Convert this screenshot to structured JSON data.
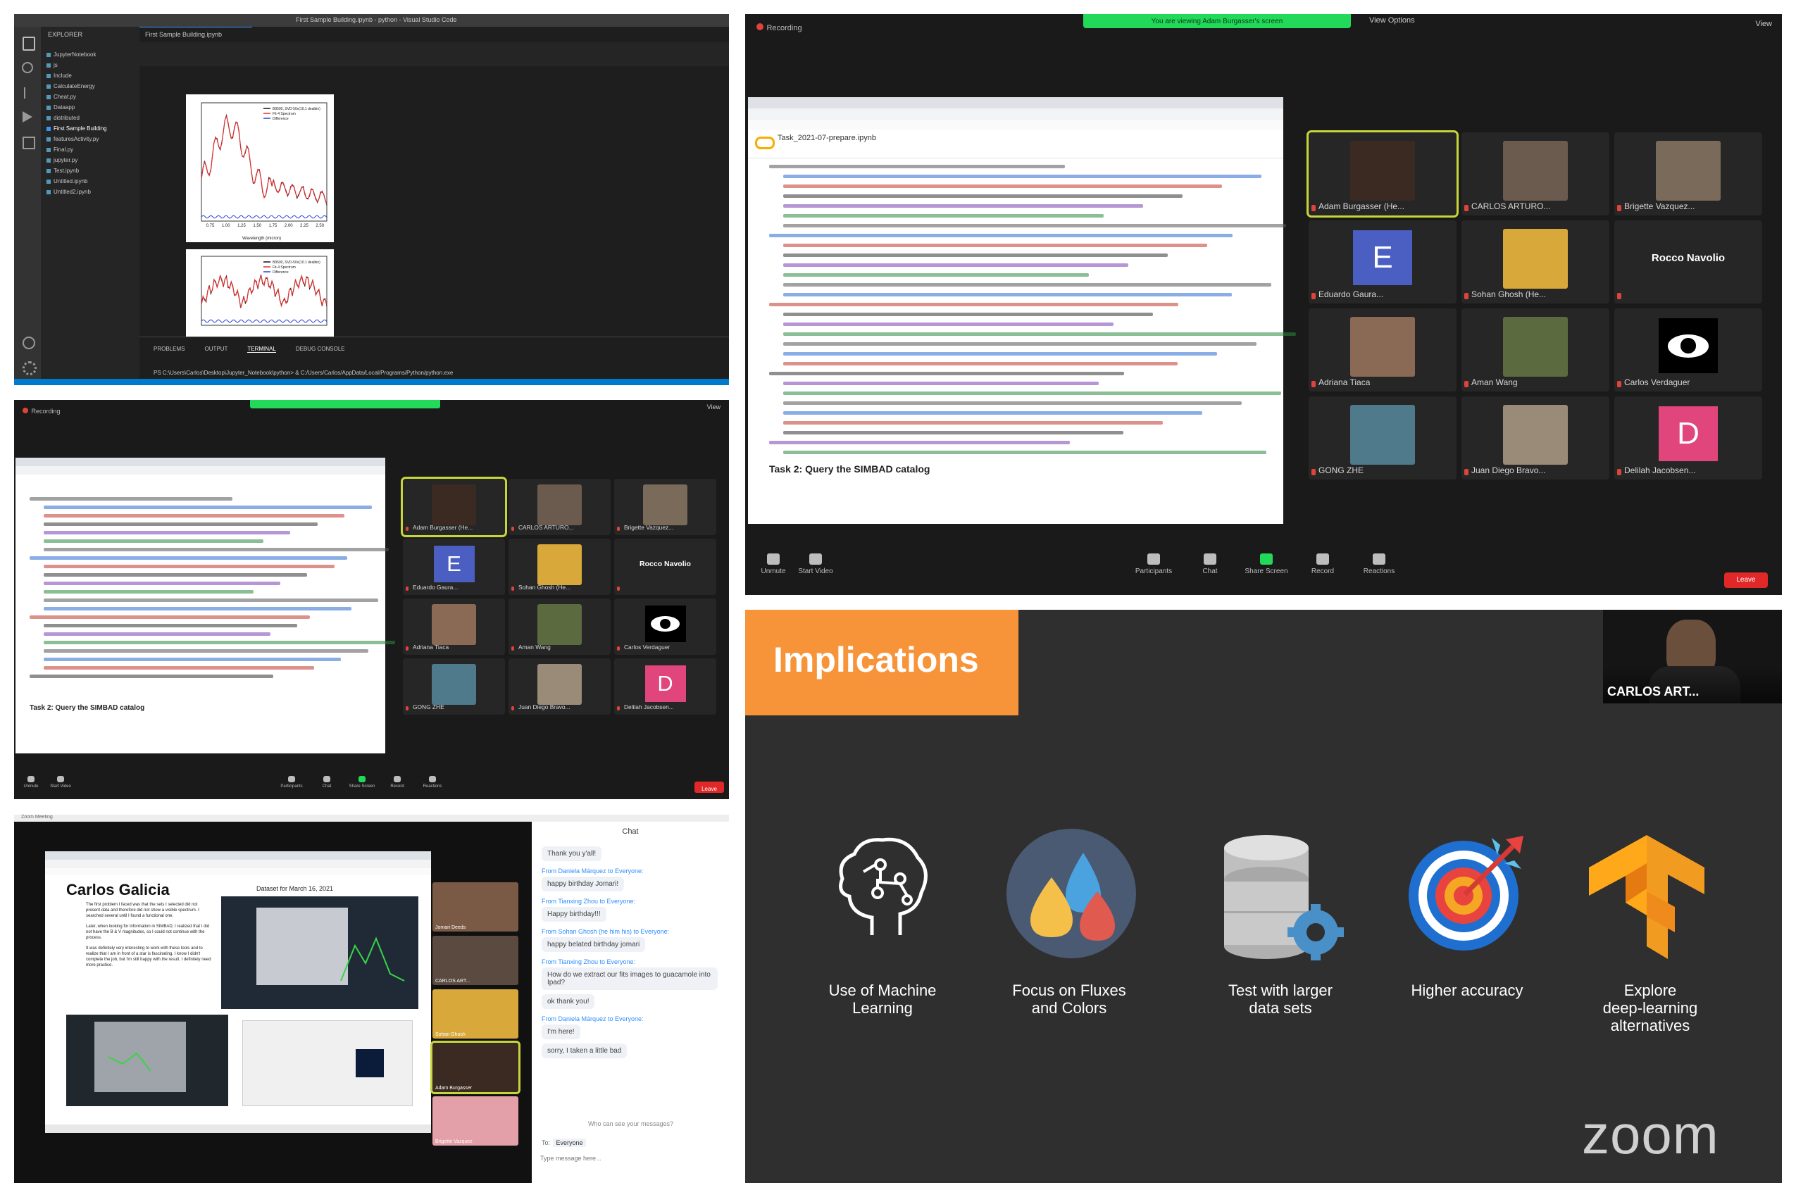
{
  "vscode_panel": {
    "window_title": "First Sample Building.ipynb - python - Visual Studio Code",
    "explorer_label": "EXPLORER",
    "files": [
      "JupyterNotebook",
      "js",
      "Include",
      "CalculateEnergy",
      "Cheat.py",
      "Dataapp",
      "distributed",
      "First Sample Building",
      "featuresActivity.py",
      "Final.py",
      "jupyter.py",
      "Test.ipynb",
      "Untitled.ipynb",
      "Untitled2.ipynb"
    ],
    "tab_label": "First Sample Building.ipynb",
    "xlabel": "Wavelength (micron)",
    "legend_top": [
      "B9500, SVD-50x(10.1 dealbin)",
      "Fit-4 Spectrum",
      "Difference"
    ],
    "legend_bottom": [
      "B9500, SVD-50x(10.1 dealbin)",
      "Fit-4 Spectrum",
      "Difference"
    ],
    "x_ticks": [
      "0.75",
      "1.00",
      "1.25",
      "1.50",
      "1.75",
      "2.00",
      "2.25",
      "2.50"
    ],
    "bottom_tabs": [
      "PROBLEMS",
      "OUTPUT",
      "TERMINAL",
      "DEBUG CONSOLE"
    ],
    "terminal_text": "PS C:\\Users\\Carlos\\Desktop\\Jupyter_Notebook\\python> & C:/Users/Carlos/AppData/Local/Programs/Python/python.exe"
  },
  "zoom_large": {
    "recording_label": "Recording",
    "share_banner": "You are viewing Adam Burgasser's screen",
    "view_options": "View Options",
    "view_label": "View",
    "notebook_title": "Task_2021-07-prepare.ipynb",
    "task_heading": "Task 2: Query the SIMBAD catalog",
    "participants": [
      {
        "name": "Adam Burgasser (He...",
        "kind": "photo",
        "color": "#3a2a22"
      },
      {
        "name": "CARLOS ARTURO...",
        "kind": "photo",
        "color": "#6b5a4e"
      },
      {
        "name": "Brigette Vazquez...",
        "kind": "photo",
        "color": "#7a6a5a"
      },
      {
        "name": "Eduardo Gaura...",
        "kind": "letter",
        "letter": "E",
        "color": "#4a5fc1"
      },
      {
        "name": "Sohan Ghosh (He...",
        "kind": "photo",
        "color": "#d8a83a"
      },
      {
        "name": "Rocco Navolio",
        "kind": "text",
        "color": "#262626"
      },
      {
        "name": "Adriana Tiaca",
        "kind": "photo",
        "color": "#8a6a55"
      },
      {
        "name": "Aman Wang",
        "kind": "photo",
        "color": "#5b6b3f"
      },
      {
        "name": "Carlos Verdaguer",
        "kind": "eye",
        "color": "#111111"
      },
      {
        "name": "GONG ZHE",
        "kind": "photo",
        "color": "#4e7a8c"
      },
      {
        "name": "Juan Diego Bravo...",
        "kind": "photo",
        "color": "#9a8a78"
      },
      {
        "name": "Delilah Jacobsen...",
        "kind": "letter",
        "letter": "D",
        "color": "#e0457b"
      }
    ],
    "toolbar": [
      "Unmute",
      "Start Video",
      "Participants",
      "Chat",
      "Share Screen",
      "Record",
      "Reactions"
    ],
    "end_label": "Leave"
  },
  "zoom_small": {
    "recording_label": "Recording",
    "view_label": "View",
    "task_heading": "Task 2: Query the SIMBAD catalog",
    "end_label": "Leave"
  },
  "chat_panel": {
    "window_title": "Zoom Meeting",
    "slide_name": "Carlos Galicia",
    "slide_caption": "Dataset for March 16, 2021",
    "slide_paragraphs": [
      "The first problem I faced was that the sets I selected did not present data and therefore did not show a visible spectrum. I searched several until I found a functional one.",
      "Later, when looking for information in SIMBAD, I realized that I did not have the B & V magnitudes, so I could not continue with the process.",
      "It was definitely very interesting to work with these tools and to realize that I am in front of a star is fascinating. I know I didn't complete the job, but I'm still happy with the result. I definitely need more practice."
    ],
    "chat_title": "Chat",
    "messages": [
      {
        "from": "",
        "text": "Thank you y'all!"
      },
      {
        "from": "From Daniela Márquez to Everyone:",
        "text": "happy birthday Jomari!"
      },
      {
        "from": "From Tianxing Zhou to Everyone:",
        "text": "Happy birthday!!!"
      },
      {
        "from": "From Sohan Ghosh (he him his) to Everyone:",
        "text": "happy belated birthday jomari"
      },
      {
        "from": "From Tianxing Zhou to Everyone:",
        "text": "How do we extract our fits images to guacamole into Ipad?"
      },
      {
        "from": "",
        "text": "ok thank you!"
      },
      {
        "from": "From Daniela Márquez to Everyone:",
        "text": "I'm here!"
      },
      {
        "from": "",
        "text": "sorry, I taken a little bad"
      }
    ],
    "to_label": "To:",
    "to_value": "Everyone",
    "input_placeholder": "Type message here...",
    "who_sees": "Who can see your messages?",
    "side_people": [
      "Jomari Deeds",
      "CARLOS ART...",
      "Sohan Ghosh",
      "Adam Burgasser",
      "Brigette Vazquez"
    ]
  },
  "slide": {
    "title": "Implications",
    "speaker_name": "CARLOS ART...",
    "items": [
      {
        "icon": "brain-circuit-icon",
        "caption": [
          "Use of Machine",
          "Learning"
        ]
      },
      {
        "icon": "water-drops-icon",
        "caption": [
          "Focus on Fluxes",
          "and Colors"
        ]
      },
      {
        "icon": "database-gear-icon",
        "caption": [
          "Test with larger",
          "data sets"
        ]
      },
      {
        "icon": "target-arrow-icon",
        "caption": [
          "Higher accuracy"
        ]
      },
      {
        "icon": "tensorflow-logo-icon",
        "caption": [
          "Explore",
          "deep-learning",
          "alternatives"
        ]
      }
    ],
    "watermark": "zoom",
    "colors": {
      "accent": "#f7943a",
      "background": "#2f2f2f",
      "drop_blue": "#4aa3df",
      "drop_yellow": "#f5c04a",
      "drop_red": "#e05a4f",
      "circle_bg": "#4a5a73"
    }
  }
}
